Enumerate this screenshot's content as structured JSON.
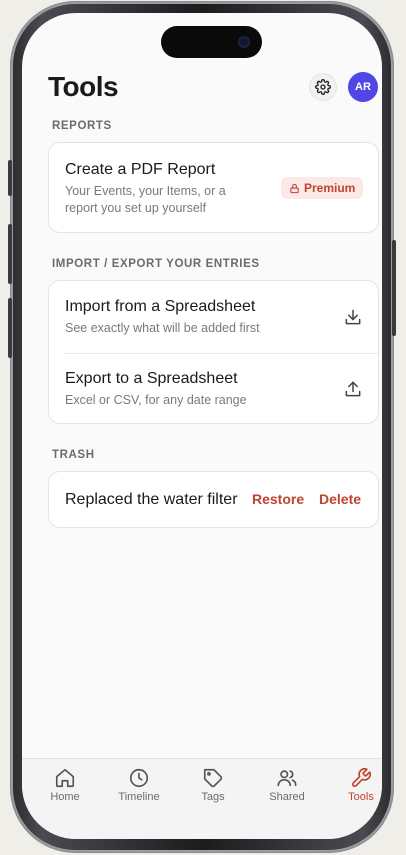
{
  "header": {
    "title": "Tools",
    "avatar_initials": "AR"
  },
  "reports": {
    "section_label": "REPORTS",
    "pdf": {
      "title": "Create a PDF Report",
      "subtitle_line1": "Your Events, your Items, or a",
      "subtitle_line2": "report you set up yourself",
      "badge": "Premium"
    }
  },
  "import_export": {
    "section_label": "IMPORT / EXPORT YOUR ENTRIES",
    "import": {
      "title": "Import from a Spreadsheet",
      "subtitle": "See exactly what will be added first"
    },
    "export": {
      "title": "Export to a Spreadsheet",
      "subtitle": "Excel or CSV, for any date range"
    }
  },
  "trash": {
    "section_label": "TRASH",
    "item": {
      "title": "Replaced the water filter",
      "restore": "Restore",
      "delete": "Delete"
    }
  },
  "tabbar": {
    "home": "Home",
    "timeline": "Timeline",
    "tags": "Tags",
    "shared": "Shared",
    "tools": "Tools"
  },
  "colors": {
    "accent": "#c0432f",
    "avatar": "#4f46e5",
    "badge_bg": "#fbe9e7"
  },
  "icons": [
    "settings-gear-icon",
    "lock-icon",
    "download-icon",
    "upload-icon",
    "home-icon",
    "clock-icon",
    "tag-icon",
    "users-icon",
    "wrench-icon"
  ]
}
